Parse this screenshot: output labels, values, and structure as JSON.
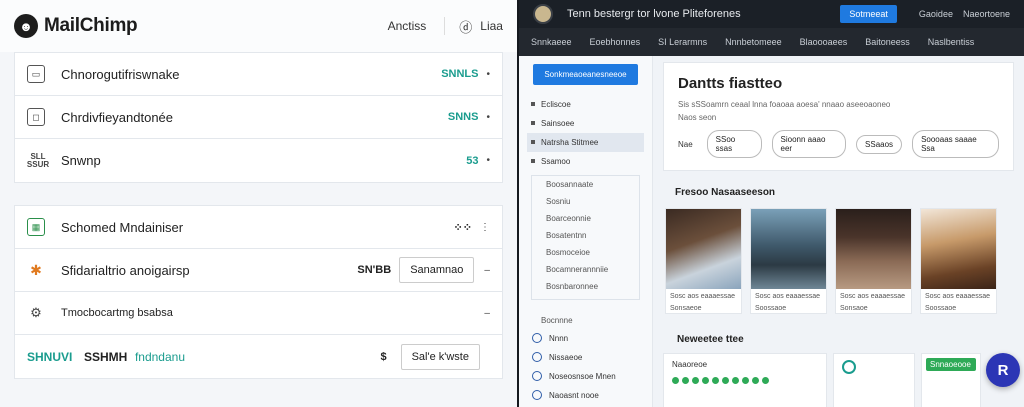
{
  "left": {
    "brand": "MailChimp",
    "header_links": [
      "Anctiss",
      "Liaa"
    ],
    "rows_top": [
      {
        "label": "Chnorogutifriswnake",
        "metric": "SNNLS"
      },
      {
        "label": "Chrdivfieyandtonée",
        "metric": "SNNS"
      },
      {
        "label": "Snwnp",
        "icon_text": "SLL\nSSUR",
        "metric": "53"
      }
    ],
    "rows_bottom": [
      {
        "label": "Schomed Mndainiser"
      },
      {
        "label": "Sfidarialtrio anoigairsp",
        "metric": "SN'BB",
        "button": "Sanamnao"
      },
      {
        "label": "Tmocbocartmg bsabsa"
      },
      {
        "label_green": "SHNUVI",
        "label_dark": "SSHMH",
        "label_teal": "fndndanu",
        "metric": "$",
        "button": "Sal'e k'wste"
      }
    ]
  },
  "right": {
    "top_title": "Tenn bestergr tor lvone Pliteforenes",
    "top_button": "Sotmeeat",
    "top_links": [
      "Gaoidee",
      "Naeortoene"
    ],
    "nav": [
      "Snnkaeee",
      "Eoebhonnes",
      "SI Lerarmns",
      "Nnnbetomeee",
      "Blaoooaees",
      "Baitoneess",
      "Naslbentiss"
    ],
    "sidebar": {
      "cta": "Sonkmeaoeanesneeoe",
      "items": [
        "Ecliscoe",
        "Sainsoee",
        "Natrsha Stitmee",
        "Ssamoo"
      ],
      "sub_items": [
        "Boosannaate",
        "Sosniu",
        "Boarceonnie",
        "Bosatentnn",
        "Bosmoceioe",
        "Bocamnerannniie",
        "Bosnbaronnee"
      ],
      "bottom_label": "Bocnnne",
      "bottom_items": [
        "Nnnn",
        "Nissaeoe",
        "Noseosnsoe Mnen",
        "Naoasnt nooe"
      ]
    },
    "main": {
      "title": "Dantts fiastteo",
      "subtitle": "Sis sSSoamrn ceaal lnna foaoaa aoesa' nnaao aseeoaoneo",
      "subline": "Naos seon",
      "chip_label": "Nae",
      "chips": [
        "SSoo ssas",
        "Sioonn aaao eer",
        "SSaaos",
        "Soooaas saaae Ssa"
      ],
      "section1": "Fresoo Nasaaseeson",
      "thumbs": [
        {
          "cap1": "Sosc aos eaaaessae",
          "cap2": "Sonsaeoe"
        },
        {
          "cap1": "Sosc aos eaaaessae",
          "cap2": "Soossaoe"
        },
        {
          "cap1": "Sosc aos eaaaessae",
          "cap2": "Sonsaoe"
        },
        {
          "cap1": "Sosc aos eaaaessae",
          "cap2": "Soossaoe"
        }
      ],
      "section2": "Neweetee ttee",
      "bottom_cards": [
        "Naaoreoe",
        "",
        "Snnaoeooe"
      ]
    },
    "fab": "R"
  }
}
